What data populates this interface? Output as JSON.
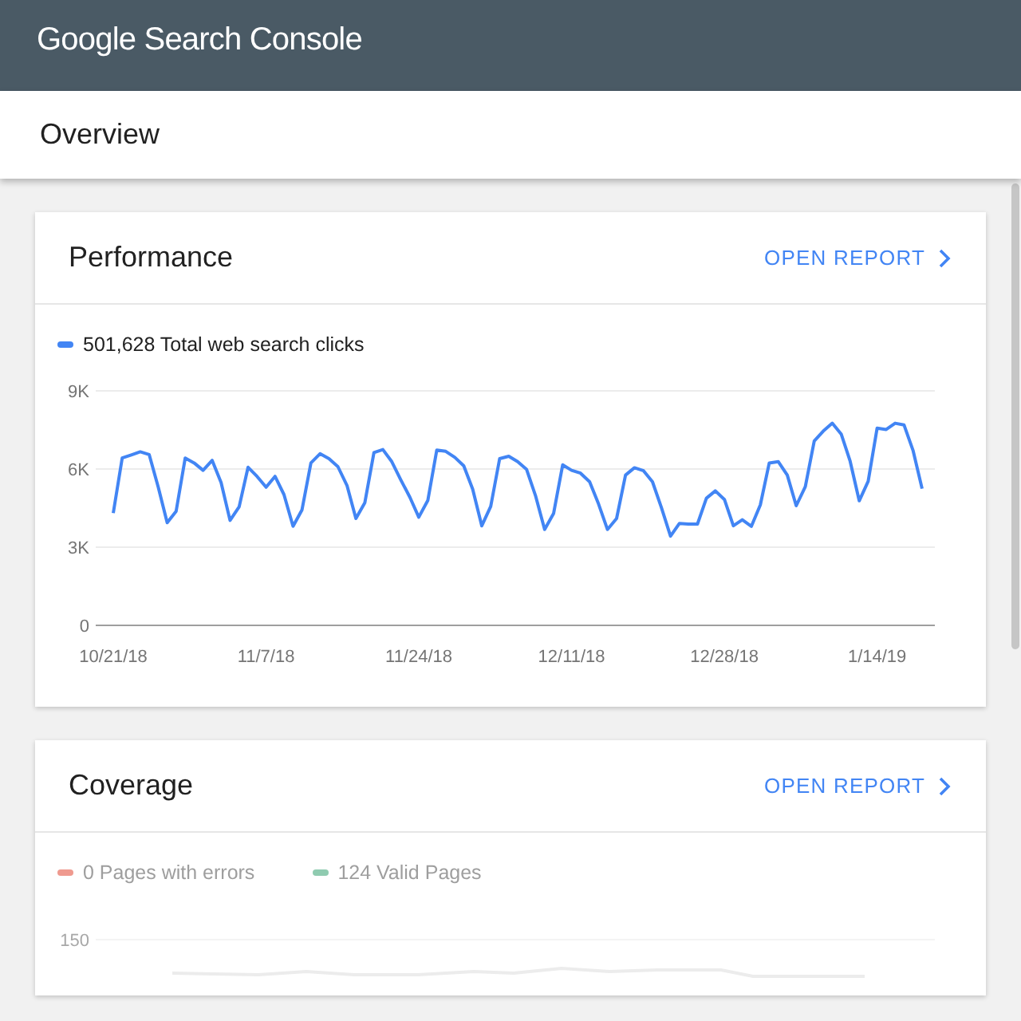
{
  "app_bar": {
    "title": "Google Search Console"
  },
  "page": {
    "title": "Overview"
  },
  "cards": [
    {
      "kind": "performance",
      "title": "Performance",
      "action": "OPEN REPORT",
      "legend": [
        {
          "text": "501,628 Total web search clicks",
          "color": "#4285f4"
        }
      ],
      "chart_data": {
        "type": "line",
        "categories": [
          "10/21/18",
          null,
          null,
          null,
          null,
          null,
          null,
          null,
          null,
          null,
          null,
          null,
          null,
          null,
          null,
          null,
          null,
          "11/7/18",
          null,
          null,
          null,
          null,
          null,
          null,
          null,
          null,
          null,
          null,
          null,
          null,
          null,
          null,
          null,
          null,
          "11/24/18",
          null,
          null,
          null,
          null,
          null,
          null,
          null,
          null,
          null,
          null,
          null,
          null,
          null,
          null,
          null,
          null,
          "12/11/18",
          null,
          null,
          null,
          null,
          null,
          null,
          null,
          null,
          null,
          null,
          null,
          null,
          null,
          null,
          null,
          null,
          "12/28/18",
          null,
          null,
          null,
          null,
          null,
          null,
          null,
          null,
          null,
          null,
          null,
          null,
          null,
          null,
          null,
          null,
          "1/14/19",
          null,
          null,
          null,
          null,
          null
        ],
        "series": [
          {
            "color": "#4285f4",
            "values": [
              4310,
              6420,
              6540,
              6660,
              6560,
              5300,
              3940,
              4380,
              6420,
              6230,
              5950,
              6330,
              5480,
              4030,
              4550,
              6070,
              5720,
              5300,
              5720,
              5020,
              3800,
              4430,
              6230,
              6590,
              6400,
              6090,
              5370,
              4100,
              4710,
              6630,
              6750,
              6280,
              5580,
              4920,
              4150,
              4800,
              6730,
              6680,
              6450,
              6120,
              5230,
              3820,
              4570,
              6400,
              6490,
              6280,
              5980,
              4950,
              3680,
              4290,
              6160,
              5950,
              5840,
              5510,
              4660,
              3680,
              4100,
              5770,
              6050,
              5930,
              5510,
              4520,
              3420,
              3910,
              3890,
              3890,
              4880,
              5160,
              4830,
              3820,
              4050,
              3800,
              4620,
              6230,
              6280,
              5770,
              4590,
              5320,
              7080,
              7450,
              7760,
              7340,
              6300,
              4780,
              5530,
              7570,
              7520,
              7760,
              7690,
              6700,
              5250
            ]
          }
        ],
        "ylim": [
          0,
          9000
        ],
        "yticks": [
          {
            "value": 0,
            "label": "0"
          },
          {
            "value": 3000,
            "label": "3K"
          },
          {
            "value": 6000,
            "label": "6K"
          },
          {
            "value": 9000,
            "label": "9K"
          }
        ]
      }
    },
    {
      "kind": "coverage",
      "title": "Coverage",
      "action": "OPEN REPORT",
      "legend": [
        {
          "text": "0 Pages with errors",
          "color": "#ef9a8f"
        },
        {
          "text": "124 Valid Pages",
          "color": "#8fcbb0"
        }
      ],
      "tick_label": "150"
    }
  ]
}
